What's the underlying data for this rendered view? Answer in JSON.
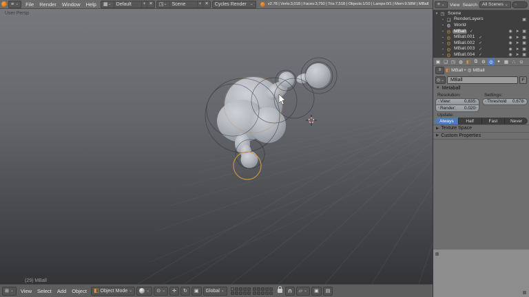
{
  "topbar": {
    "menus": [
      "File",
      "Render",
      "Window",
      "Help"
    ],
    "layout_name": "Default",
    "scene_name": "Scene",
    "engine": "Cycles Render",
    "stats": "v2.78 | Verts:3,018 | Faces:3,750 | Tris:7,518 | Objects:1/10 | Lamps:0/1 | Mem:9.58M | MBall"
  },
  "viewport": {
    "view_label": "User Persp",
    "active_object_label": "(29) MBall",
    "header": {
      "menus": [
        "View",
        "Select",
        "Add",
        "Object"
      ],
      "mode": "Object Mode",
      "orientation": "Global",
      "active_layer": 0
    }
  },
  "outliner": {
    "header_menus": [
      "View",
      "Search"
    ],
    "scope": "All Scenes",
    "items": [
      {
        "label": "Scene",
        "icon": "scene",
        "expander": "▾",
        "indent": 0,
        "selected": false,
        "extra": false,
        "right": []
      },
      {
        "label": "RenderLayers",
        "icon": "layers",
        "expander": "•",
        "indent": 1,
        "selected": false,
        "extra": false,
        "right": [
          "camera"
        ]
      },
      {
        "label": "World",
        "icon": "world",
        "expander": "•",
        "indent": 1,
        "selected": false,
        "extra": false,
        "right": []
      },
      {
        "label": "MBall",
        "icon": "meta",
        "expander": "•",
        "indent": 1,
        "selected": true,
        "extra": true,
        "right": [
          "eye",
          "pointer",
          "camera"
        ]
      },
      {
        "label": "MBall.001",
        "icon": "meta",
        "expander": "•",
        "indent": 1,
        "selected": false,
        "extra": true,
        "right": [
          "eye",
          "pointer",
          "camera"
        ]
      },
      {
        "label": "MBall.002",
        "icon": "meta",
        "expander": "•",
        "indent": 1,
        "selected": false,
        "extra": true,
        "right": [
          "eye",
          "pointer",
          "camera"
        ]
      },
      {
        "label": "MBall.003",
        "icon": "meta",
        "expander": "•",
        "indent": 1,
        "selected": false,
        "extra": true,
        "right": [
          "eye",
          "pointer",
          "camera"
        ]
      },
      {
        "label": "MBall.004",
        "icon": "meta",
        "expander": "•",
        "indent": 1,
        "selected": false,
        "extra": true,
        "right": [
          "eye",
          "pointer",
          "camera"
        ]
      }
    ]
  },
  "properties": {
    "tabs": [
      {
        "name": "render",
        "glyph": "▣",
        "active": false
      },
      {
        "name": "render-layers",
        "glyph": "❏",
        "active": false
      },
      {
        "name": "scene",
        "glyph": "◳",
        "active": false
      },
      {
        "name": "world",
        "glyph": "◍",
        "active": false
      },
      {
        "name": "object",
        "glyph": "◧",
        "active": false,
        "tint": "#e0912f"
      },
      {
        "name": "constraints",
        "glyph": "⧉",
        "active": false
      },
      {
        "name": "modifiers",
        "glyph": "⚙",
        "active": false
      },
      {
        "name": "object-data",
        "glyph": "◎",
        "active": true
      },
      {
        "name": "material",
        "glyph": "●",
        "active": false
      },
      {
        "name": "texture",
        "glyph": "▦",
        "active": false
      },
      {
        "name": "particles",
        "glyph": "∴",
        "active": false
      },
      {
        "name": "physics",
        "glyph": "⊙",
        "active": false
      }
    ],
    "breadcrumb": {
      "object": "MBall",
      "data": "MBall"
    },
    "name_value": "MBall",
    "fake_user_label": "F",
    "metaball": {
      "title": "Metaball",
      "resolution_label": "Resolution:",
      "settings_label": "Settings:",
      "view_label": "View:",
      "view_value": "0.835",
      "render_label": "Render:",
      "render_value": "0.020",
      "threshold_label": "Threshold",
      "threshold_value": "0.678",
      "update_label": "Update:",
      "update_options": [
        "Always",
        "Half",
        "Fast",
        "Never"
      ],
      "update_active": 0
    },
    "collapsed_panels": [
      "Texture Space",
      "Custom Properties"
    ]
  },
  "icons": {
    "info-editor": "≡",
    "dropdown": "⌄",
    "layout": "▦",
    "scene": "◳",
    "plus": "+",
    "close": "✕",
    "search": "○",
    "world": "◍",
    "layers": "❏",
    "meta": "◎",
    "eye": "◉",
    "pointer": "➤",
    "camera": "▣",
    "check": "✓",
    "cube": "◧",
    "pivot": "⊙",
    "translate": "✛",
    "rotate": "↻",
    "scale": "▣",
    "magnet": "∪",
    "grid3d": "⊞",
    "panel-open": "▼",
    "panel-closed": "▶",
    "breadcrumb-sep": "▸",
    "snap-element": "▱",
    "render-still": "▣",
    "render-anim": "▤"
  },
  "colors": {
    "accent_blue": "#4f79bd",
    "accent_orange": "#e0912f",
    "selection_ring": "#cf9643",
    "meta_icon": "#e6ad3c",
    "viewport_top": "#76787d",
    "viewport_bottom": "#333437"
  }
}
